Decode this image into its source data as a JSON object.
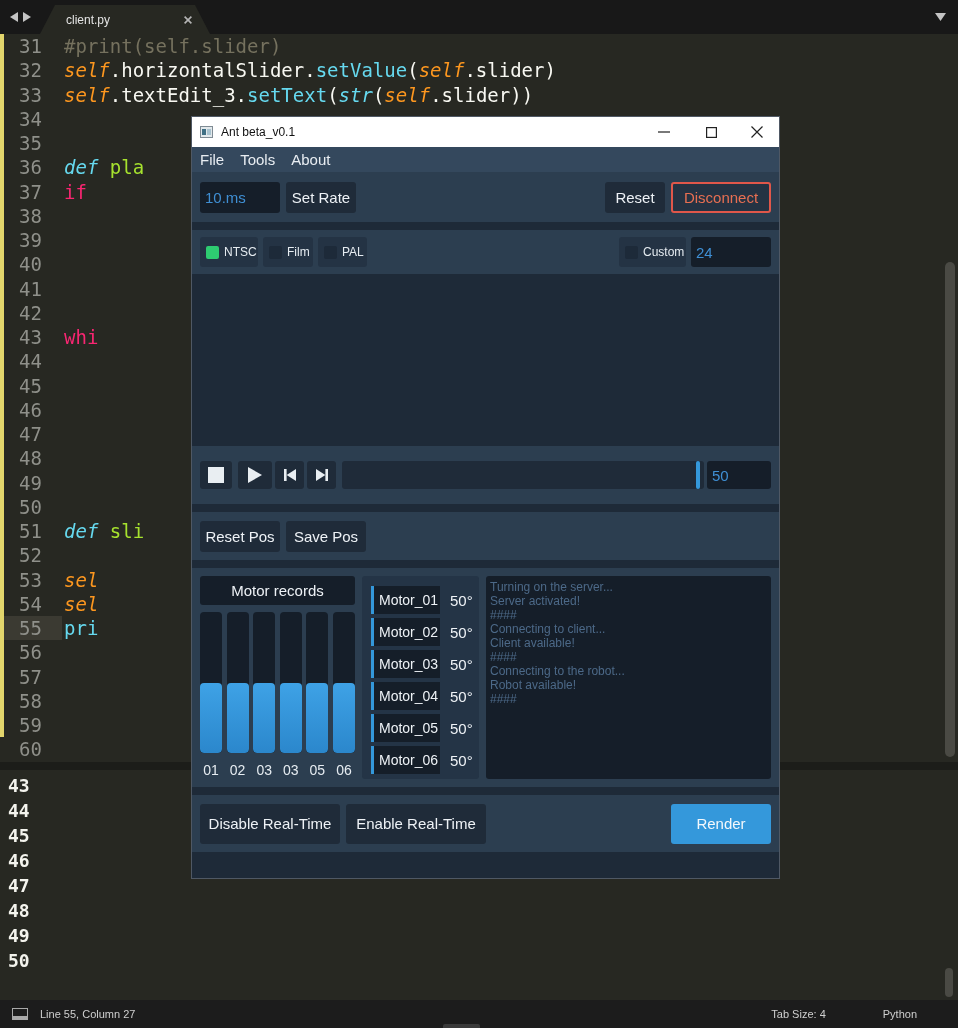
{
  "editor": {
    "tabs": [
      {
        "label": "client.py",
        "selected": true
      }
    ],
    "lines": [
      {
        "number": "31",
        "current": false,
        "modified": true,
        "tokens": [
          {
            "kind": "comment",
            "text": "        #print(self.slider)"
          }
        ]
      },
      {
        "number": "32",
        "current": false,
        "modified": true,
        "tokens": [
          {
            "kind": "self",
            "text": "        self"
          },
          {
            "kind": "plain",
            "text": ".horizontalSlider."
          },
          {
            "kind": "call",
            "text": "setValue"
          },
          {
            "kind": "plain",
            "text": "("
          },
          {
            "kind": "self",
            "text": "self"
          },
          {
            "kind": "plain",
            "text": ".slider)"
          }
        ]
      },
      {
        "number": "33",
        "current": false,
        "modified": true,
        "tokens": [
          {
            "kind": "self",
            "text": "        self"
          },
          {
            "kind": "plain",
            "text": ".textEdit_3."
          },
          {
            "kind": "call",
            "text": "setText"
          },
          {
            "kind": "plain",
            "text": "("
          },
          {
            "kind": "builtin",
            "text": "str"
          },
          {
            "kind": "plain",
            "text": "("
          },
          {
            "kind": "self",
            "text": "self"
          },
          {
            "kind": "plain",
            "text": ".slider))"
          }
        ]
      },
      {
        "number": "34",
        "current": false,
        "modified": true
      },
      {
        "number": "35",
        "current": false,
        "modified": true
      },
      {
        "number": "36",
        "current": false,
        "modified": true,
        "tokens": [
          {
            "kind": "storage",
            "text": "    def"
          },
          {
            "kind": "function",
            "text": " pla"
          }
        ]
      },
      {
        "number": "37",
        "current": false,
        "modified": true,
        "tokens": [
          {
            "kind": "keyword",
            "text": "        if"
          }
        ]
      },
      {
        "number": "38",
        "current": false,
        "modified": true
      },
      {
        "number": "39",
        "current": false,
        "modified": true
      },
      {
        "number": "40",
        "current": false,
        "modified": true
      },
      {
        "number": "41",
        "current": false,
        "modified": true
      },
      {
        "number": "42",
        "current": false,
        "modified": true
      },
      {
        "number": "43",
        "current": false,
        "modified": true,
        "tokens": [
          {
            "kind": "keyword",
            "text": "        whi"
          }
        ]
      },
      {
        "number": "44",
        "current": false,
        "modified": true
      },
      {
        "number": "45",
        "current": false,
        "modified": true
      },
      {
        "number": "46",
        "current": false,
        "modified": true
      },
      {
        "number": "47",
        "current": false,
        "modified": true
      },
      {
        "number": "48",
        "current": false,
        "modified": true
      },
      {
        "number": "49",
        "current": false,
        "modified": true
      },
      {
        "number": "50",
        "current": false,
        "modified": true
      },
      {
        "number": "51",
        "current": false,
        "modified": true,
        "tokens": [
          {
            "kind": "storage",
            "text": "    def"
          },
          {
            "kind": "function",
            "text": " sli"
          }
        ]
      },
      {
        "number": "52",
        "current": false,
        "modified": true
      },
      {
        "number": "53",
        "current": false,
        "modified": true,
        "tokens": [
          {
            "kind": "self",
            "text": "        sel"
          }
        ]
      },
      {
        "number": "54",
        "current": false,
        "modified": true,
        "tokens": [
          {
            "kind": "self",
            "text": "        sel"
          }
        ]
      },
      {
        "number": "55",
        "current": true,
        "modified": true,
        "tokens": [
          {
            "kind": "call",
            "text": "        pri"
          }
        ]
      },
      {
        "number": "56",
        "current": false,
        "modified": true
      },
      {
        "number": "57",
        "current": false,
        "modified": true
      },
      {
        "number": "58",
        "current": false,
        "modified": true
      },
      {
        "number": "59",
        "current": false,
        "modified": true
      },
      {
        "number": "60",
        "current": false,
        "modified": false
      }
    ]
  },
  "console": {
    "lines": [
      "43",
      "44",
      "45",
      "46",
      "47",
      "48",
      "49",
      "50"
    ]
  },
  "status_bar": {
    "position": "Line 55, Column 27",
    "tab_size": "Tab Size: 4",
    "syntax": "Python"
  },
  "app_window": {
    "title": "Ant beta_v0.1",
    "menu": [
      "File",
      "Tools",
      "About"
    ],
    "rate": {
      "value": "10.ms",
      "buttons": [
        {
          "label": "Set Rate",
          "kind": "normal"
        }
      ],
      "actions": [
        {
          "label": "Reset",
          "kind": "normal"
        },
        {
          "label": "Disconnect",
          "kind": "danger"
        }
      ]
    },
    "frame_rates": [
      {
        "label": "NTSC",
        "checked": true
      },
      {
        "label": "Film",
        "checked": false
      },
      {
        "label": "PAL",
        "checked": false
      }
    ],
    "custom_rate": {
      "label": "Custom",
      "checked": false,
      "value": "24"
    },
    "playback": {
      "buttons": [
        {
          "kind": "stop"
        },
        {
          "kind": "play"
        },
        {
          "kind": "previous"
        },
        {
          "kind": "next"
        }
      ],
      "level": 0.99,
      "value": "50"
    },
    "position_buttons": [
      {
        "label": "Reset Pos",
        "kind": "normal"
      },
      {
        "label": "Save Pos",
        "kind": "normal"
      }
    ],
    "motor_records": {
      "title": "Motor records",
      "bars": [
        {
          "label": "01",
          "level": 0.5
        },
        {
          "label": "02",
          "level": 0.5
        },
        {
          "label": "03",
          "level": 0.5
        },
        {
          "label": "03",
          "level": 0.5
        },
        {
          "label": "05",
          "level": 0.5
        },
        {
          "label": "06",
          "level": 0.5
        }
      ]
    },
    "motors": [
      {
        "name": "Motor_01",
        "angle": "50°"
      },
      {
        "name": "Motor_02",
        "angle": "50°"
      },
      {
        "name": "Motor_03",
        "angle": "50°"
      },
      {
        "name": "Motor_04",
        "angle": "50°"
      },
      {
        "name": "Motor_05",
        "angle": "50°"
      },
      {
        "name": "Motor_06",
        "angle": "50°"
      }
    ],
    "log": [
      "Turning on the server...",
      "Server activated!",
      "####",
      "Connecting to client...",
      "Client available!",
      "####",
      "Connecting to the robot...",
      "Robot available!",
      "####"
    ],
    "realtime_buttons": [
      {
        "label": "Disable Real-Time",
        "kind": "normal"
      },
      {
        "label": "Enable Real-Time",
        "kind": "normal"
      }
    ],
    "render_button": {
      "label": "Render",
      "kind": "primary"
    }
  }
}
